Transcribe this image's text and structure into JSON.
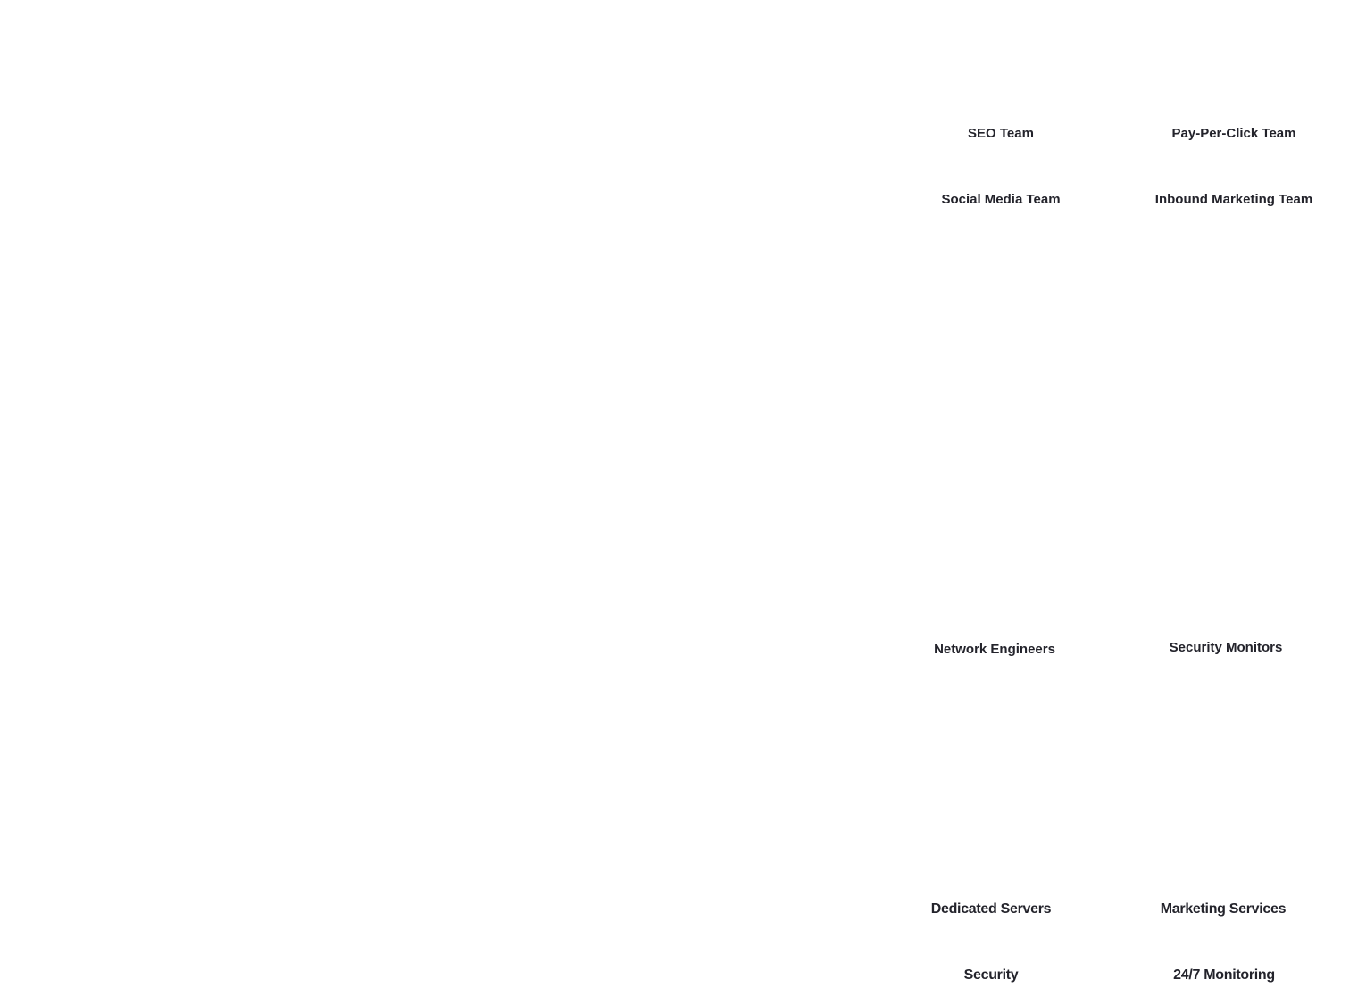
{
  "teams": [
    {
      "label": "SEO Team"
    },
    {
      "label": "Pay-Per-Click Team"
    },
    {
      "label": "Social Media Team"
    },
    {
      "label": "Inbound Marketing Team"
    }
  ],
  "staff": [
    {
      "label": "Network Engineers"
    },
    {
      "label": "Security Monitors"
    }
  ],
  "features": [
    {
      "label": "Dedicated Servers"
    },
    {
      "label": "Marketing Services"
    },
    {
      "label": "Security"
    },
    {
      "label": "24/7 Monitoring"
    }
  ],
  "colors": {
    "text": "#23232b",
    "background": "#ffffff"
  }
}
